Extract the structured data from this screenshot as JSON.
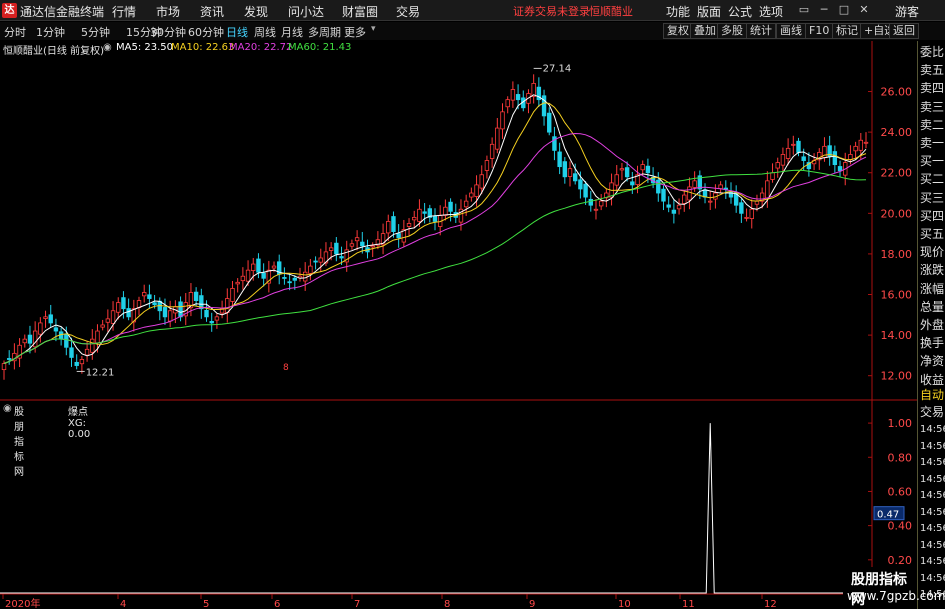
{
  "app": {
    "logo": "达",
    "title": "通达信金融终端",
    "menus": [
      "行情",
      "市场",
      "资讯",
      "发现",
      "问小达",
      "财富圈",
      "交易"
    ],
    "warning": "证券交易未登录",
    "stock_name": "恒顺醋业",
    "right_menus": [
      "功能",
      "版面",
      "公式",
      "选项"
    ],
    "window_buttons": [
      "▭",
      "─",
      "□",
      "✕"
    ],
    "guest": "游客"
  },
  "periods": [
    "分时",
    "1分钟",
    "5分钟",
    "15分钟",
    "30分钟",
    "60分钟",
    "日线",
    "周线",
    "月线",
    "多周期",
    "更多"
  ],
  "active_period": "日线",
  "right_buttons": [
    "复权",
    "叠加",
    "多股",
    "统计",
    "画线",
    "F10",
    "标记",
    "+自选",
    "返回"
  ],
  "main_legend": {
    "name": "恒顺醋业(日线 前复权)",
    "ma5": "MA5: 23.50",
    "ma10": "MA10: 22.63",
    "ma20": "MA20: 22.72",
    "ma60": "MA60: 21.43"
  },
  "sub_legend": {
    "indicator": "股朋指标网",
    "value": "爆点XG: 0.00"
  },
  "colors": {
    "up": "#ff3a3a",
    "down": "#20d0e8",
    "ma5": "#ffffff",
    "ma10": "#f5d020",
    "ma20": "#e040e0",
    "ma60": "#40e040",
    "axis": "#aa1010",
    "signal": "#ffffff"
  },
  "price_axis": [
    "26.00",
    "24.00",
    "22.00",
    "20.00",
    "18.00",
    "16.00",
    "14.00",
    "12.00"
  ],
  "indicator_axis": [
    "1.00",
    "0.80",
    "0.60",
    "0.40",
    "0.20"
  ],
  "indicator_current": "0.47",
  "annotations": {
    "high": "27.14",
    "low": "12.21",
    "marker": "8"
  },
  "time_axis": [
    "2020年",
    "4",
    "5",
    "6",
    "7",
    "8",
    "9",
    "10",
    "11",
    "12"
  ],
  "right_panel": {
    "labels": [
      "委比",
      "卖五",
      "卖四",
      "卖三",
      "卖二",
      "卖一",
      "买一",
      "买二",
      "买三",
      "买四",
      "买五",
      "现价",
      "涨跌",
      "涨幅",
      "总量",
      "外盘",
      "换手",
      "净资",
      "收益"
    ],
    "mode": [
      "自动",
      "交易"
    ],
    "times": [
      "14:56",
      "14:56",
      "14:56",
      "14:56",
      "14:56",
      "14:56",
      "14:56",
      "14:56",
      "14:56",
      "14:56",
      "14:56"
    ]
  },
  "watermark": {
    "line1": "股朋指标网",
    "line2": "www.7gpzb.com"
  },
  "chart_data": {
    "type": "candlestick",
    "ylim": [
      11.0,
      27.8
    ],
    "closes": [
      12.6,
      12.8,
      13.1,
      13.5,
      13.8,
      13.6,
      14.2,
      14.6,
      14.9,
      14.6,
      14.2,
      13.8,
      13.4,
      12.9,
      12.5,
      12.8,
      13.3,
      13.8,
      14.2,
      14.5,
      14.8,
      15.2,
      15.6,
      15.3,
      14.9,
      15.3,
      15.7,
      16.1,
      15.8,
      15.5,
      15.2,
      14.9,
      15.2,
      15.4,
      14.9,
      15.6,
      16.1,
      15.7,
      15.3,
      14.9,
      14.6,
      14.9,
      15.3,
      15.8,
      16.3,
      16.6,
      16.9,
      17.2,
      17.5,
      17.1,
      16.8,
      17.2,
      17.4,
      17.0,
      16.8,
      16.6,
      16.7,
      16.9,
      17.1,
      17.4,
      17.6,
      17.8,
      18.1,
      18.3,
      18.0,
      17.8,
      18.2,
      18.5,
      18.8,
      18.4,
      18.1,
      18.4,
      18.7,
      19.0,
      19.6,
      19.1,
      18.8,
      19.2,
      19.5,
      19.8,
      20.2,
      20.0,
      19.8,
      19.6,
      19.9,
      20.3,
      20.1,
      19.8,
      20.2,
      20.6,
      21.0,
      21.4,
      21.9,
      22.6,
      23.4,
      24.2,
      25.0,
      25.6,
      26.1,
      25.6,
      25.2,
      25.9,
      26.4,
      25.6,
      24.8,
      24.0,
      23.1,
      22.3,
      21.8,
      22.2,
      21.6,
      21.2,
      20.8,
      20.4,
      20.2,
      20.6,
      21.0,
      21.5,
      21.9,
      22.2,
      21.8,
      21.4,
      21.9,
      22.4,
      22.0,
      21.5,
      21.0,
      20.6,
      20.3,
      20.0,
      20.4,
      20.9,
      21.3,
      21.6,
      21.2,
      20.8,
      20.6,
      21.0,
      21.4,
      21.2,
      20.8,
      20.4,
      20.0,
      19.8,
      20.2,
      20.6,
      21.0,
      21.6,
      22.0,
      22.5,
      22.9,
      23.2,
      23.4,
      23.0,
      22.6,
      22.2,
      22.6,
      23.0,
      23.3,
      22.8,
      22.4,
      22.1,
      22.5,
      22.9,
      23.3,
      23.6,
      23.5
    ],
    "signal_index": 136,
    "signal_value": 1.0,
    "indicator_ylim": [
      0,
      1.1
    ]
  }
}
